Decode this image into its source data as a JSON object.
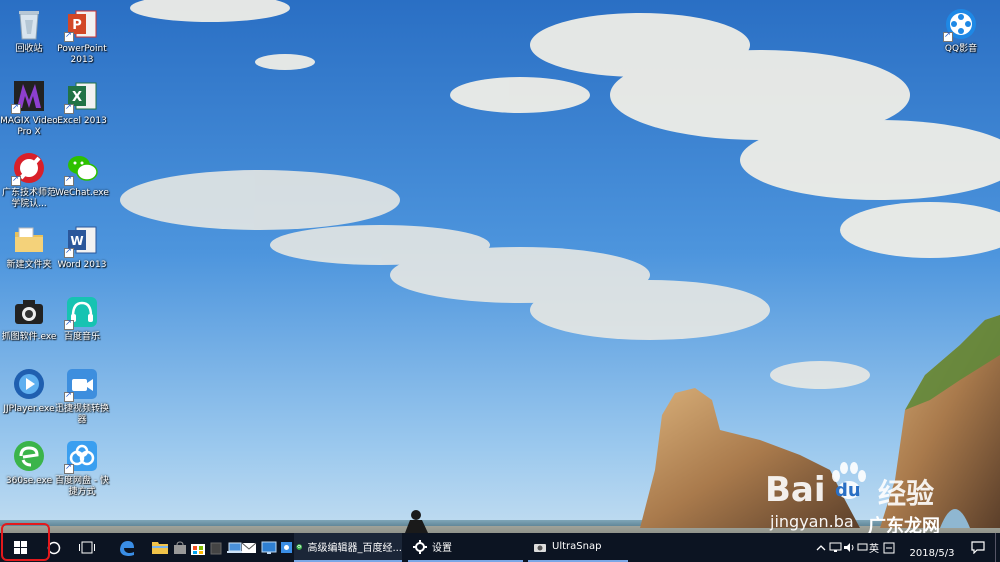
{
  "desktop": {
    "icons": [
      {
        "label": "回收站"
      },
      {
        "label": "PowerPoint 2013"
      },
      {
        "label": "MAGIX Video Pro X"
      },
      {
        "label": "Excel 2013"
      },
      {
        "label": "广东技术师范学院认..."
      },
      {
        "label": "WeChat.exe"
      },
      {
        "label": "新建文件夹"
      },
      {
        "label": "Word 2013"
      },
      {
        "label": "抓图软件.exe"
      },
      {
        "label": "百度音乐"
      },
      {
        "label": "JJPlayer.exe"
      },
      {
        "label": "迅捷视频转换器"
      },
      {
        "label": "360se.exe"
      },
      {
        "label": "百度网盘 - 快捷方式"
      },
      {
        "label": "QQ影音"
      }
    ]
  },
  "watermark": {
    "baidu_text": "Bai",
    "baidu_text2": "du",
    "jingyan_text": "经验",
    "url_text": "jingyan.ba",
    "site_text": "广东龙网"
  },
  "taskbar": {
    "search_label": "",
    "apps": [
      {
        "label": "高级编辑器_百度经..."
      },
      {
        "label": "设置"
      },
      {
        "label": "UltraSnap"
      }
    ],
    "tray": {
      "input_lang": "英",
      "date": "2018/5/3"
    }
  },
  "colors": {
    "accent": "#e3191c",
    "taskbar": "#0c1422"
  }
}
